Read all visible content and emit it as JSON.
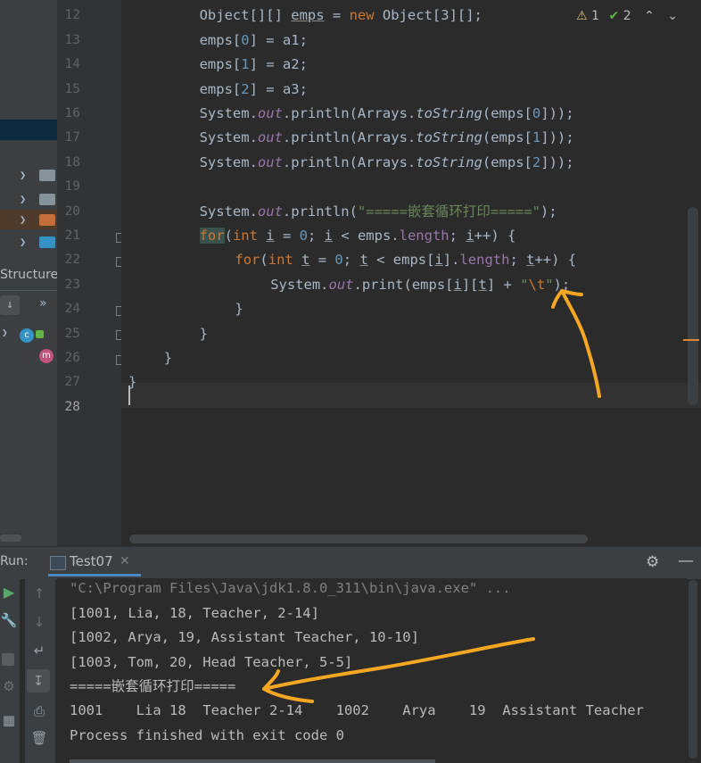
{
  "editor": {
    "line_numbers": [
      "12",
      "13",
      "14",
      "15",
      "16",
      "17",
      "18",
      "19",
      "20",
      "21",
      "22",
      "23",
      "24",
      "25",
      "26",
      "27",
      "28"
    ],
    "lines": [
      {
        "indent": 4,
        "tokens": [
          {
            "t": "Object[][] ",
            "c": ""
          },
          {
            "t": "emps",
            "c": "ul"
          },
          {
            "t": " = ",
            "c": ""
          },
          {
            "t": "new",
            "c": "kw"
          },
          {
            "t": " Object[3][];",
            "c": ""
          }
        ]
      },
      {
        "indent": 4,
        "tokens": [
          {
            "t": "emps[",
            "c": ""
          },
          {
            "t": "0",
            "c": "num"
          },
          {
            "t": "] = a1;",
            "c": ""
          }
        ]
      },
      {
        "indent": 4,
        "tokens": [
          {
            "t": "emps[",
            "c": ""
          },
          {
            "t": "1",
            "c": "num"
          },
          {
            "t": "] = a2;",
            "c": ""
          }
        ]
      },
      {
        "indent": 4,
        "tokens": [
          {
            "t": "emps[",
            "c": ""
          },
          {
            "t": "2",
            "c": "num"
          },
          {
            "t": "] = a3;",
            "c": ""
          }
        ]
      },
      {
        "indent": 4,
        "tokens": [
          {
            "t": "System.",
            "c": ""
          },
          {
            "t": "out",
            "c": "fld"
          },
          {
            "t": ".println(Arrays.",
            "c": ""
          },
          {
            "t": "toString",
            "c": "mt-i"
          },
          {
            "t": "(emps[",
            "c": ""
          },
          {
            "t": "0",
            "c": "num"
          },
          {
            "t": "]));",
            "c": ""
          }
        ]
      },
      {
        "indent": 4,
        "tokens": [
          {
            "t": "System.",
            "c": ""
          },
          {
            "t": "out",
            "c": "fld"
          },
          {
            "t": ".println(Arrays.",
            "c": ""
          },
          {
            "t": "toString",
            "c": "mt-i"
          },
          {
            "t": "(emps[",
            "c": ""
          },
          {
            "t": "1",
            "c": "num"
          },
          {
            "t": "]));",
            "c": ""
          }
        ]
      },
      {
        "indent": 4,
        "tokens": [
          {
            "t": "System.",
            "c": ""
          },
          {
            "t": "out",
            "c": "fld"
          },
          {
            "t": ".println(Arrays.",
            "c": ""
          },
          {
            "t": "toString",
            "c": "mt-i"
          },
          {
            "t": "(emps[",
            "c": ""
          },
          {
            "t": "2",
            "c": "num"
          },
          {
            "t": "]));",
            "c": ""
          }
        ]
      },
      {
        "indent": 0,
        "tokens": []
      },
      {
        "indent": 4,
        "tokens": [
          {
            "t": "System.",
            "c": ""
          },
          {
            "t": "out",
            "c": "fld"
          },
          {
            "t": ".println(",
            "c": ""
          },
          {
            "t": "\"=====嵌套循环打印=====\"",
            "c": "st"
          },
          {
            "t": ");",
            "c": ""
          }
        ]
      },
      {
        "indent": 4,
        "tokens": [
          {
            "t": "for",
            "c": "kw-hl"
          },
          {
            "t": "(",
            "c": ""
          },
          {
            "t": "int",
            "c": "kw"
          },
          {
            "t": " ",
            "c": ""
          },
          {
            "t": "i",
            "c": "ul"
          },
          {
            "t": " = ",
            "c": ""
          },
          {
            "t": "0",
            "c": "num"
          },
          {
            "t": "; ",
            "c": ""
          },
          {
            "t": "i",
            "c": "ul"
          },
          {
            "t": " < emps.",
            "c": ""
          },
          {
            "t": "length",
            "c": "fld-n"
          },
          {
            "t": "; ",
            "c": ""
          },
          {
            "t": "i",
            "c": "ul"
          },
          {
            "t": "++) {",
            "c": ""
          }
        ]
      },
      {
        "indent": 6,
        "tokens": [
          {
            "t": "for",
            "c": "kw"
          },
          {
            "t": "(",
            "c": ""
          },
          {
            "t": "int",
            "c": "kw"
          },
          {
            "t": " ",
            "c": ""
          },
          {
            "t": "t",
            "c": "ul"
          },
          {
            "t": " = ",
            "c": ""
          },
          {
            "t": "0",
            "c": "num"
          },
          {
            "t": "; ",
            "c": ""
          },
          {
            "t": "t",
            "c": "ul"
          },
          {
            "t": " < emps[",
            "c": ""
          },
          {
            "t": "i",
            "c": "ul"
          },
          {
            "t": "].",
            "c": ""
          },
          {
            "t": "length",
            "c": "fld-n"
          },
          {
            "t": "; ",
            "c": ""
          },
          {
            "t": "t",
            "c": "ul"
          },
          {
            "t": "++) {",
            "c": ""
          }
        ]
      },
      {
        "indent": 8,
        "tokens": [
          {
            "t": "System.",
            "c": ""
          },
          {
            "t": "out",
            "c": "fld"
          },
          {
            "t": ".print(emps[",
            "c": ""
          },
          {
            "t": "i",
            "c": "ul"
          },
          {
            "t": "][",
            "c": ""
          },
          {
            "t": "t",
            "c": "ul"
          },
          {
            "t": "] + ",
            "c": ""
          },
          {
            "t": "\"",
            "c": "st"
          },
          {
            "t": "\\t",
            "c": "esc"
          },
          {
            "t": "\"",
            "c": "st"
          },
          {
            "t": ");",
            "c": ""
          }
        ]
      },
      {
        "indent": 6,
        "tokens": [
          {
            "t": "}",
            "c": ""
          }
        ]
      },
      {
        "indent": 4,
        "tokens": [
          {
            "t": "}",
            "c": ""
          }
        ]
      },
      {
        "indent": 2,
        "tokens": [
          {
            "t": "}",
            "c": ""
          }
        ]
      },
      {
        "indent": 0,
        "tokens": [
          {
            "t": "}",
            "c": ""
          }
        ]
      },
      {
        "indent": 0,
        "tokens": []
      }
    ],
    "inspections": {
      "warnings": "1",
      "weak_warnings": "2"
    }
  },
  "sidebar": {
    "structure_label": "Structure"
  },
  "run": {
    "label": "Run:",
    "tab_label": "Test07",
    "output": [
      {
        "text": "\"C:\\Program Files\\Java\\jdk1.8.0_311\\bin\\java.exe\" ...",
        "kind": "cmd"
      },
      {
        "text": "[1001, Lia, 18, Teacher, 2-14]",
        "kind": "out"
      },
      {
        "text": "[1002, Arya, 19, Assistant Teacher, 10-10]",
        "kind": "out"
      },
      {
        "text": "[1003, Tom, 20, Head Teacher, 5-5]",
        "kind": "out"
      },
      {
        "text": "=====嵌套循环打印=====",
        "kind": "out"
      },
      {
        "text": "1001    Lia 18  Teacher 2-14    1002    Arya    19  Assistant Teacher",
        "kind": "out"
      },
      {
        "text": "Process finished with exit code 0",
        "kind": "out"
      }
    ]
  },
  "colors": {
    "annotation": "#f5a623",
    "accent": "#4a88c7"
  }
}
